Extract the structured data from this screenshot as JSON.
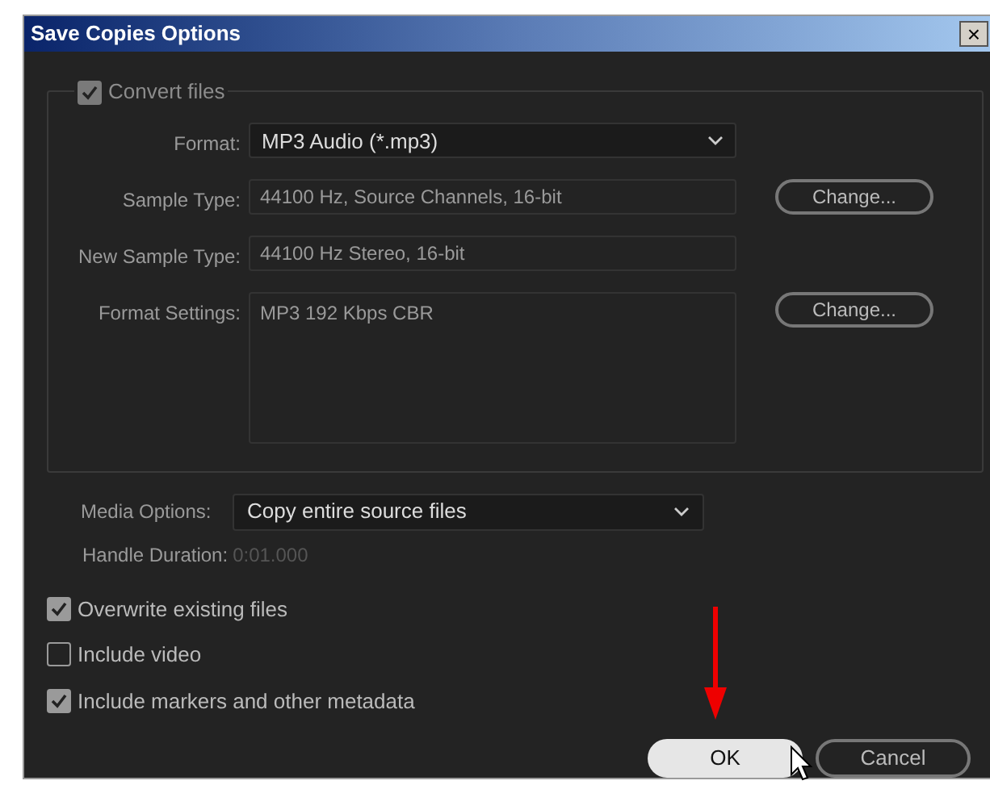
{
  "window": {
    "title": "Save Copies Options",
    "close": "×"
  },
  "convert_files": {
    "label": "Convert files",
    "checked": true
  },
  "rows": [
    {
      "kind": "select",
      "label": "Format:",
      "value": "MP3 Audio (*.mp3)"
    },
    {
      "kind": "text",
      "label": "Sample Type:",
      "value": "44100 Hz, Source Channels, 16-bit",
      "button": "Change..."
    },
    {
      "kind": "text",
      "label": "New Sample Type:",
      "value": "44100 Hz Stereo, 16-bit"
    },
    {
      "kind": "area",
      "label": "Format Settings:",
      "value": "MP3 192 Kbps CBR",
      "button": "Change..."
    }
  ],
  "media_options": {
    "label": "Media Options:",
    "value": "Copy entire source files"
  },
  "handle_duration": {
    "label": "Handle Duration:",
    "value": "0:01.000",
    "disabled": true
  },
  "options": [
    {
      "label": "Overwrite existing files",
      "checked": true
    },
    {
      "label": "Include video",
      "checked": false
    },
    {
      "label": "Include markers and other metadata",
      "checked": true
    }
  ],
  "buttons": [
    {
      "label": "OK",
      "selected": true
    },
    {
      "label": "Cancel",
      "selected": false
    }
  ]
}
